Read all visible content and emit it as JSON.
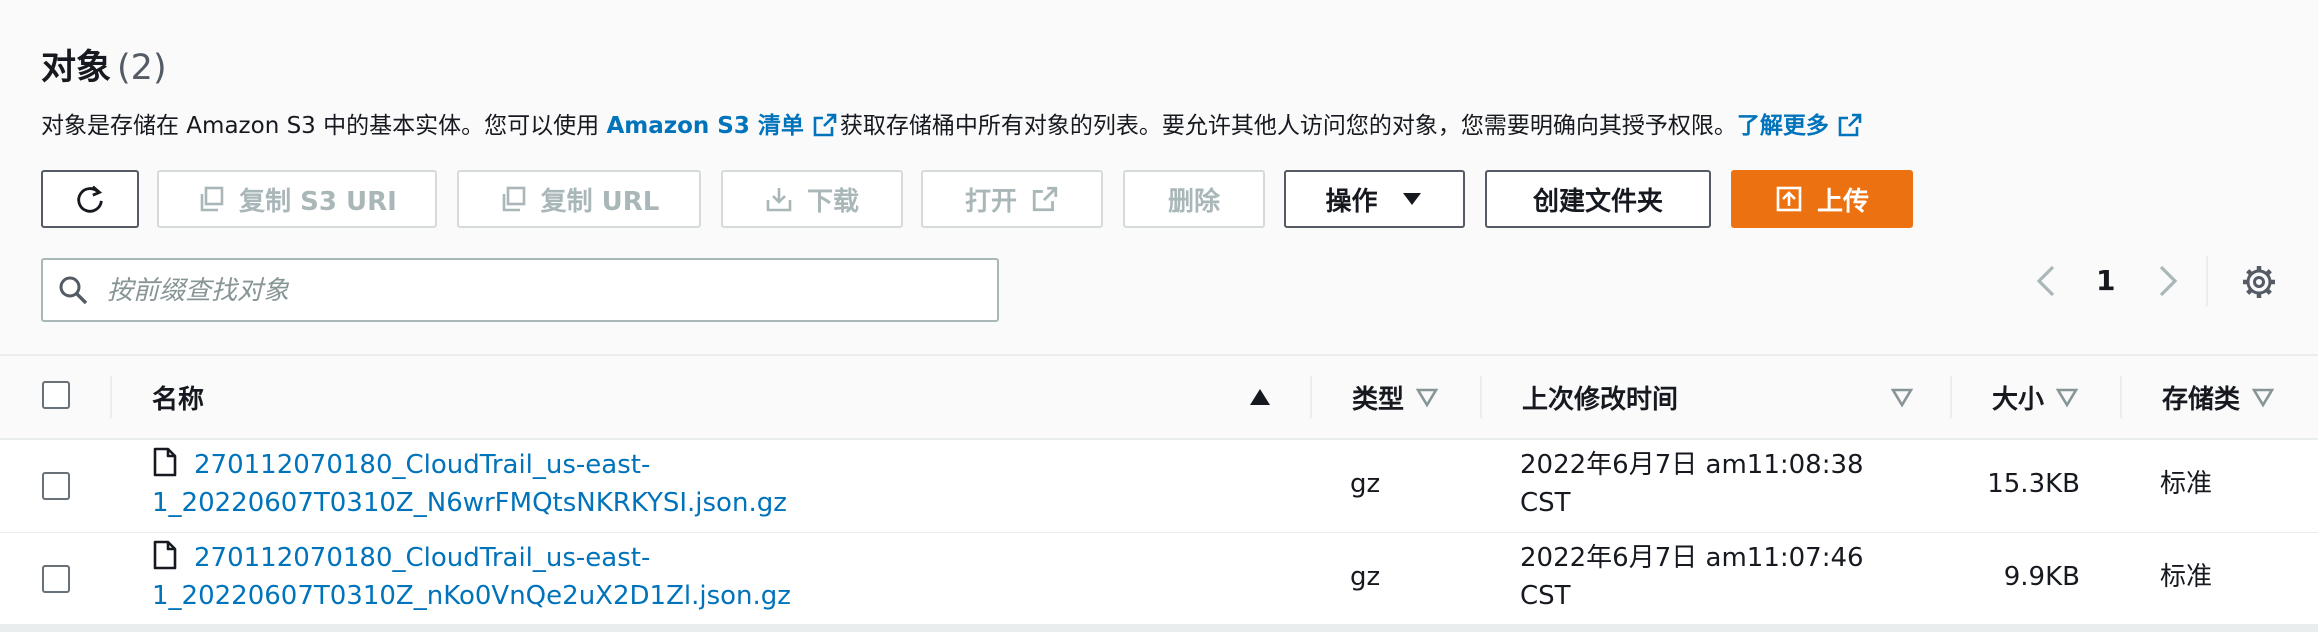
{
  "header": {
    "title": "对象",
    "count": "(2)"
  },
  "description": {
    "text1": "对象是存储在 Amazon S3 中的基本实体。您可以使用 ",
    "link1": "Amazon S3 清单",
    "text2": "获取存储桶中所有对象的列表。要允许其他人访问您的对象，您需要明确向其授予权限。",
    "link2": "了解更多"
  },
  "toolbar": {
    "copy_s3_uri": "复制 S3 URI",
    "copy_url": "复制 URL",
    "download": "下载",
    "open": "打开",
    "delete": "删除",
    "actions": "操作",
    "create_folder": "创建文件夹",
    "upload": "上传"
  },
  "search": {
    "placeholder": "按前缀查找对象"
  },
  "pagination": {
    "current_page": "1"
  },
  "table": {
    "columns": {
      "name": "名称",
      "type": "类型",
      "last_modified": "上次修改时间",
      "size": "大小",
      "storage_class": "存储类"
    },
    "rows": [
      {
        "name_line1": "270112070180_CloudTrail_us-east-",
        "name_line2": "1_20220607T0310Z_N6wrFMQtsNKRKYSI.json.gz",
        "type": "gz",
        "modified_line1": "2022年6月7日 am11:08:38",
        "modified_line2": "CST",
        "size": "15.3KB",
        "storage_class": "标准"
      },
      {
        "name_line1": "270112070180_CloudTrail_us-east-",
        "name_line2": "1_20220607T0310Z_nKo0VnQe2uX2D1Zl.json.gz",
        "type": "gz",
        "modified_line1": "2022年6月7日 am11:07:46",
        "modified_line2": "CST",
        "size": "9.9KB",
        "storage_class": "标准"
      }
    ]
  },
  "colors": {
    "accent_orange": "#ec7211",
    "link_blue": "#0073bb",
    "text": "#16191f",
    "disabled": "#aab7b8"
  },
  "icons": [
    "refresh-icon",
    "copy-icon",
    "download-icon",
    "external-link-icon",
    "caret-down-icon",
    "upload-icon",
    "search-icon",
    "chevron-left-icon",
    "chevron-right-icon",
    "gear-icon",
    "sort-ascending-icon",
    "sort-icon",
    "file-icon"
  ]
}
